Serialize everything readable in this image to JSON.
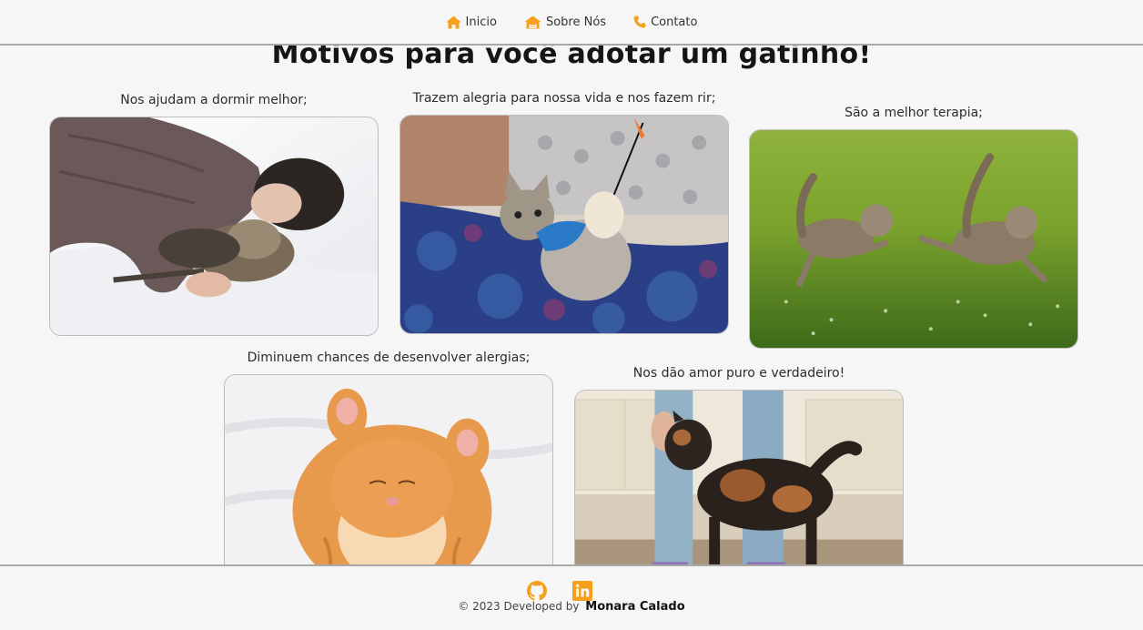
{
  "nav": {
    "items": [
      {
        "label": "Inicio",
        "icon": "home-icon"
      },
      {
        "label": "Sobre Nós",
        "icon": "cat-house-icon"
      },
      {
        "label": "Contato",
        "icon": "phone-icon"
      }
    ]
  },
  "main": {
    "title": "Motivos para você adotar um gatinho!",
    "cards": [
      {
        "caption": "Nos ajudam a dormir melhor;",
        "photo": "woman-sleeping-with-cats"
      },
      {
        "caption": "Trazem alegria para nossa vida e nos fazem rir;",
        "photo": "kitten-playing-with-toy"
      },
      {
        "caption": "São a melhor terapia;",
        "photo": "kittens-running-on-grass"
      },
      {
        "caption": "Diminuem chances de desenvolver alergias;",
        "photo": "orange-kitten-sleeping"
      },
      {
        "caption": "Nos dão amor puro e verdadeiro!",
        "photo": "tortoiseshell-cat-being-petted"
      }
    ]
  },
  "footer": {
    "social": [
      {
        "icon": "github-icon"
      },
      {
        "icon": "linkedin-icon"
      }
    ],
    "copyright": "© 2023 Developed by",
    "developer": "Monara Calado"
  },
  "colors": {
    "accent": "#f59f1b",
    "background": "#f6f6f6",
    "divider": "#a8a8a8"
  }
}
